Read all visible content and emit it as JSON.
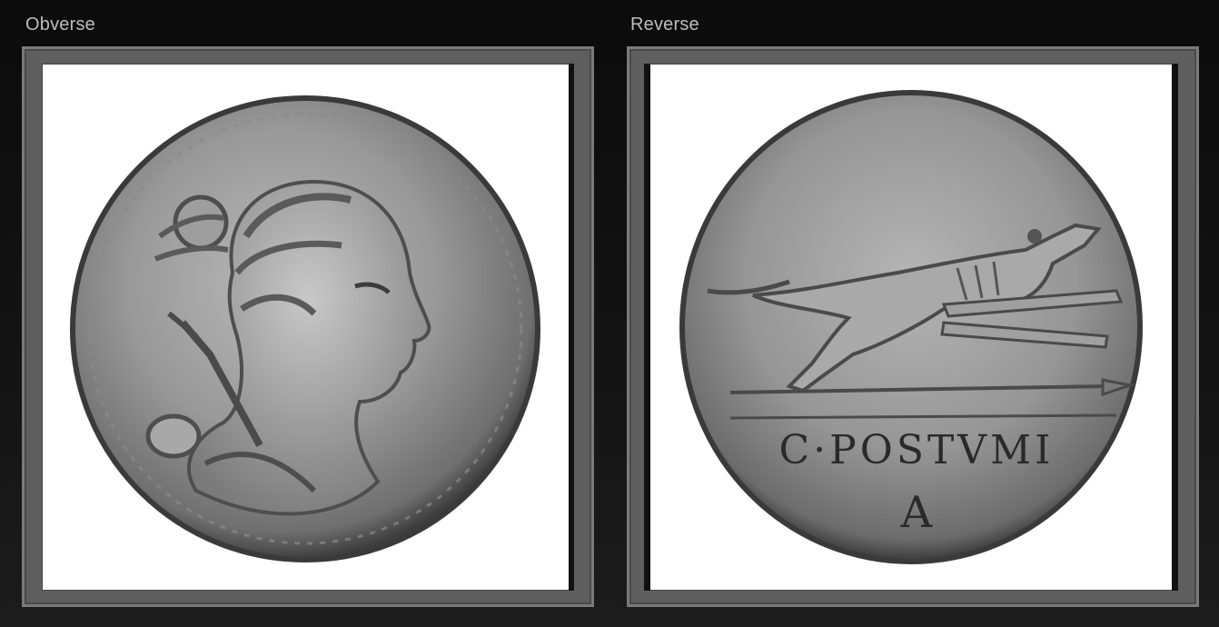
{
  "panels": {
    "obverse": {
      "label": "Obverse"
    },
    "reverse": {
      "label": "Reverse",
      "legend": "C·POSTVMI",
      "mark": "A"
    }
  },
  "colors": {
    "background": "#111111",
    "frame": "#5f5f5f",
    "coin_silver": "#8c8c8c",
    "coin_shadow": "#3a3a3a"
  }
}
